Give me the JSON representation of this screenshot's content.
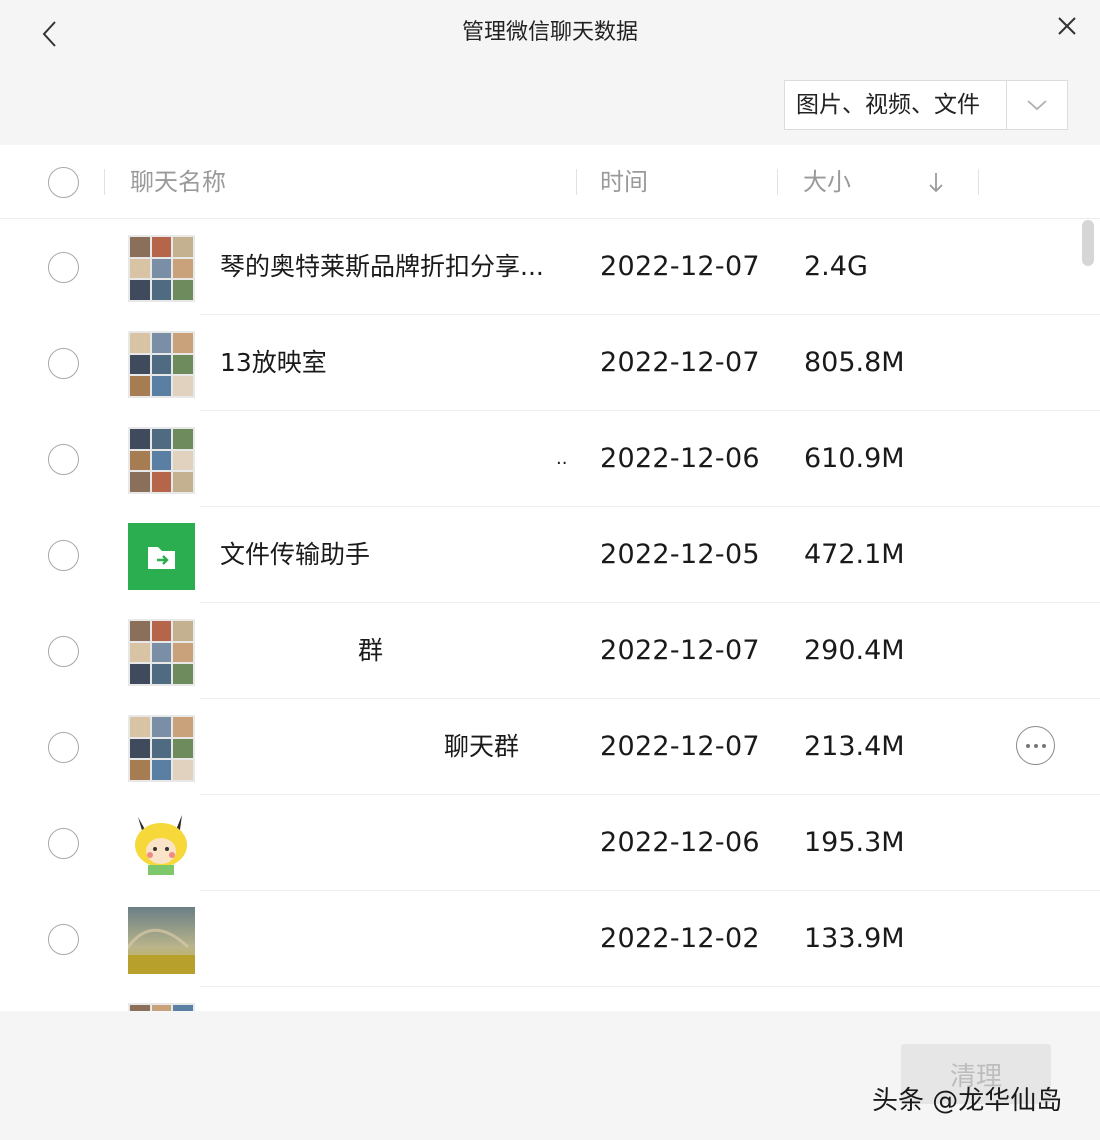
{
  "window": {
    "title": "管理微信聊天数据",
    "filter": {
      "selected": "图片、视频、文件"
    }
  },
  "table": {
    "headers": {
      "name": "聊天名称",
      "time": "时间",
      "size": "大小",
      "sort": "descending"
    },
    "rows": [
      {
        "name": "琴的奥特莱斯品牌折扣分享...",
        "time": "2022-12-07",
        "size": "2.4G",
        "avatar": "group-grid"
      },
      {
        "name": "13放映室",
        "time": "2022-12-07",
        "size": "805.8M",
        "avatar": "group-grid"
      },
      {
        "name": "..",
        "time": "2022-12-06",
        "size": "610.9M",
        "avatar": "group-grid"
      },
      {
        "name": "文件传输助手",
        "time": "2022-12-05",
        "size": "472.1M",
        "avatar": "file-transfer-icon"
      },
      {
        "name": "群",
        "time": "2022-12-07",
        "size": "290.4M",
        "avatar": "group-grid"
      },
      {
        "name": "聊天群",
        "time": "2022-12-07",
        "size": "213.4M",
        "avatar": "group-grid",
        "more": true
      },
      {
        "name": "",
        "time": "2022-12-06",
        "size": "195.3M",
        "avatar": "pikachu-avatar"
      },
      {
        "name": "",
        "time": "2022-12-02",
        "size": "133.9M",
        "avatar": "rainbow-photo"
      }
    ]
  },
  "footer": {
    "clean_label": "清理"
  },
  "watermark": "头条 @龙华仙岛",
  "colors": {
    "accent_green": "#2aae4f",
    "text": "#1a1a1a",
    "muted": "#9a9a9a",
    "disabled": "#bdbdbd"
  }
}
